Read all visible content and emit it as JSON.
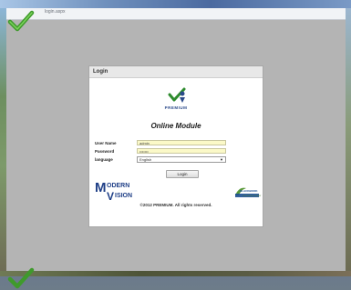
{
  "browser": {
    "address_text": "login.aspx"
  },
  "login": {
    "header_title": "Login",
    "logo_text": "PREMIUM",
    "module_title": "Online Module",
    "fields": {
      "username": {
        "label": "User Name",
        "value": "admin"
      },
      "password": {
        "label": "Password",
        "value": "•••••••"
      },
      "language": {
        "label": "language",
        "value": "English"
      }
    },
    "login_button": "Login",
    "footer_logo": {
      "modern_big_m": "M",
      "modern_rest": "ODERN",
      "vision_big_v": "V",
      "vision_rest": "ISION"
    },
    "partner_logo": {
      "name": "BLACKBOOK",
      "tagline": "everything simpler"
    },
    "copyright": "©2012 PREMIUM. All rights reserved."
  },
  "colors": {
    "accent_blue": "#1f3f87",
    "field_bg": "#fbf9c8",
    "check_green": "#3f9a2c"
  }
}
